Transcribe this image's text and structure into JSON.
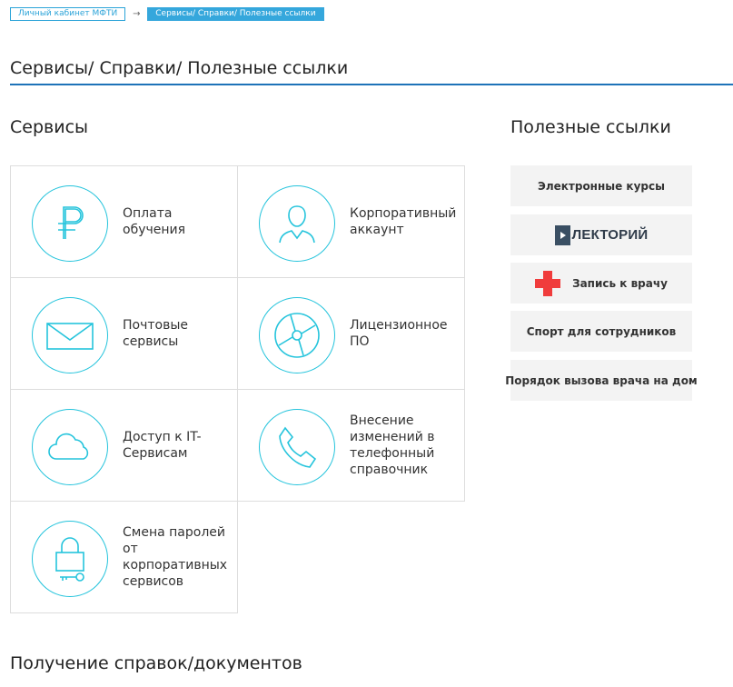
{
  "breadcrumb": {
    "home": "Личный кабинет МФТИ",
    "separator": "→",
    "current": "Сервисы/ Справки/ Полезные ссылки"
  },
  "page_title": "Сервисы/ Справки/ Полезные ссылки",
  "services": {
    "title": "Сервисы",
    "tiles": [
      {
        "label": "Оплата обучения",
        "icon": "ruble-icon"
      },
      {
        "label": "Корпоративный аккаунт",
        "icon": "user-icon"
      },
      {
        "label": "Почтовые сервисы",
        "icon": "envelope-icon"
      },
      {
        "label": "Лицензионное ПО",
        "icon": "disc-icon"
      },
      {
        "label": "Доступ к IT-Сервисам",
        "icon": "cloud-icon"
      },
      {
        "label": "Внесение изменений в телефонный справочник",
        "icon": "phone-icon"
      },
      {
        "label": "Смена паролей от корпоративных сервисов",
        "icon": "lock-icon"
      }
    ]
  },
  "useful_links": {
    "title": "Полезные ссылки",
    "items": [
      {
        "label": "Электронные курсы"
      },
      {
        "label": "ЛЕКТОРИЙ",
        "icon": "lektory-logo"
      },
      {
        "label": "Запись к врачу",
        "icon": "red-cross-icon"
      },
      {
        "label": "Спорт для сотрудников"
      },
      {
        "label": "Порядок вызова врача на дом"
      }
    ]
  },
  "documents": {
    "title": "Получение справок/документов"
  },
  "colors": {
    "accent": "#35a7dc",
    "icon_stroke": "#25c4dc",
    "title_rule": "#1e73b8",
    "cross": "#f03c3c",
    "link_bg": "#f3f3f3"
  }
}
